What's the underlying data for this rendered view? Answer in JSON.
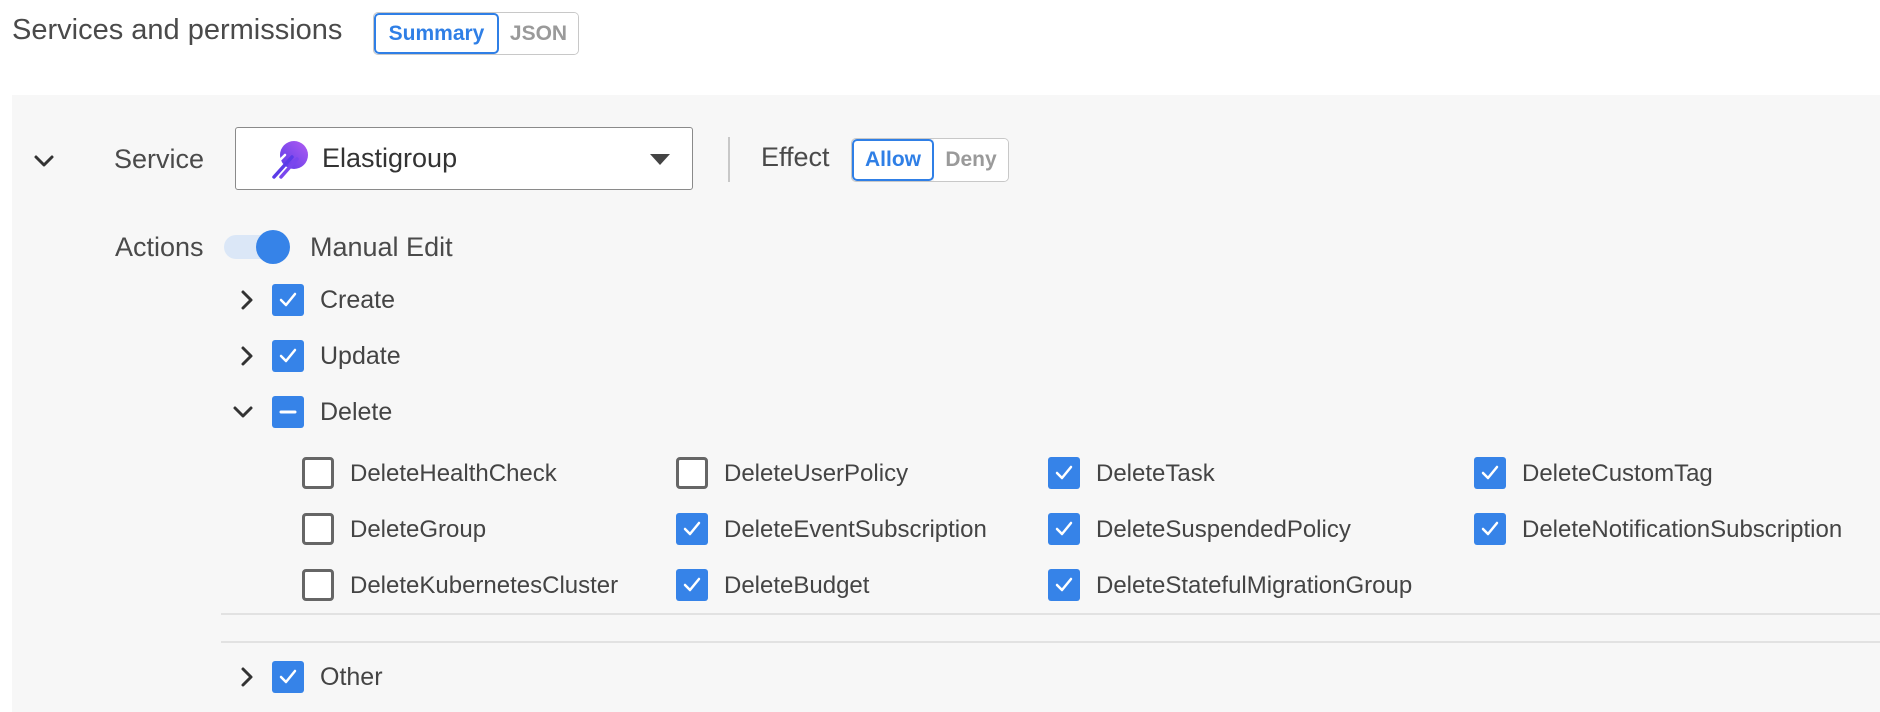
{
  "header": {
    "title": "Services and permissions"
  },
  "view_toggle": {
    "options": [
      "Summary",
      "JSON"
    ],
    "selected": "Summary"
  },
  "service": {
    "label": "Service",
    "selected": "Elastigroup",
    "icon": "elastigroup-icon"
  },
  "effect": {
    "label": "Effect",
    "options": [
      "Allow",
      "Deny"
    ],
    "selected": "Allow"
  },
  "actions": {
    "label": "Actions",
    "manual_edit_label": "Manual Edit",
    "manual_edit_on": true,
    "groups": [
      {
        "name": "Create",
        "expanded": false,
        "state": "checked"
      },
      {
        "name": "Update",
        "expanded": false,
        "state": "checked"
      },
      {
        "name": "Delete",
        "expanded": true,
        "state": "mixed"
      },
      {
        "name": "Other",
        "expanded": false,
        "state": "checked"
      }
    ],
    "delete_items": [
      {
        "name": "DeleteHealthCheck",
        "checked": false
      },
      {
        "name": "DeleteUserPolicy",
        "checked": false
      },
      {
        "name": "DeleteTask",
        "checked": true
      },
      {
        "name": "DeleteCustomTag",
        "checked": true
      },
      {
        "name": "DeleteGroup",
        "checked": false
      },
      {
        "name": "DeleteEventSubscription",
        "checked": true
      },
      {
        "name": "DeleteSuspendedPolicy",
        "checked": true
      },
      {
        "name": "DeleteNotificationSubscription",
        "checked": true
      },
      {
        "name": "DeleteKubernetesCluster",
        "checked": false
      },
      {
        "name": "DeleteBudget",
        "checked": true
      },
      {
        "name": "DeleteStatefulMigrationGroup",
        "checked": true
      }
    ]
  },
  "colors": {
    "accent": "#3683e8",
    "panel_bg": "#f7f7f7"
  }
}
